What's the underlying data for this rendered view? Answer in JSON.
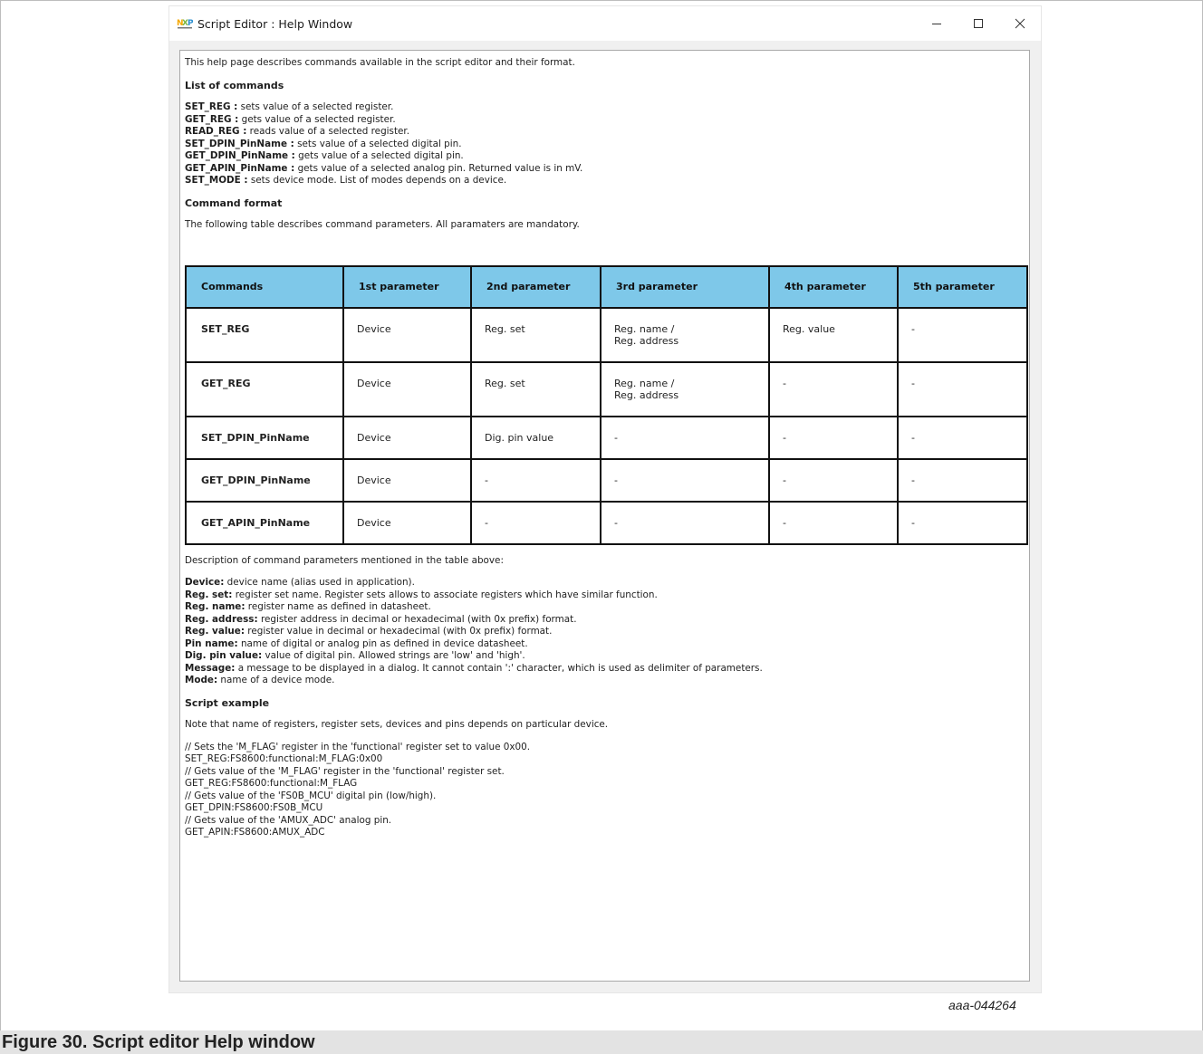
{
  "window": {
    "title": "Script Editor : Help Window",
    "app_icon": "nxp-logo-icon",
    "controls": {
      "minimize": "minimize-icon",
      "maximize": "maximize-icon",
      "close": "close-icon"
    }
  },
  "help": {
    "intro": "This help page describes commands available in the script editor and their format.",
    "list_heading": "List of commands",
    "commands": [
      {
        "name": "SET_REG :",
        "desc": " sets value of a selected register."
      },
      {
        "name": "GET_REG :",
        "desc": " gets value of a selected register."
      },
      {
        "name": "READ_REG :",
        "desc": " reads value of a selected register."
      },
      {
        "name": "SET_DPIN_PinName :",
        "desc": " sets value of a selected digital pin."
      },
      {
        "name": "GET_DPIN_PinName :",
        "desc": " gets value of a selected digital pin."
      },
      {
        "name": "GET_APIN_PinName :",
        "desc": " gets value of a selected analog pin. Returned value is in mV."
      },
      {
        "name": "SET_MODE :",
        "desc": " sets device mode. List of modes depends on a device."
      }
    ],
    "format_heading": "Command format",
    "format_text": "The following table describes command parameters. All paramaters are mandatory.",
    "table": {
      "headers": [
        "Commands",
        "1st parameter",
        "2nd parameter",
        "3rd parameter",
        "4th parameter",
        "5th parameter"
      ],
      "rows": [
        [
          "SET_REG",
          "Device",
          "Reg. set",
          "Reg. name /",
          "Reg. value",
          "-"
        ],
        [
          "GET_REG",
          "Device",
          "Reg. set",
          "Reg. name /",
          "-",
          "-"
        ],
        [
          "SET_DPIN_PinName",
          "Device",
          "Dig. pin value",
          "-",
          "-",
          "-"
        ],
        [
          "GET_DPIN_PinName",
          "Device",
          "-",
          "-",
          "-",
          "-"
        ],
        [
          "GET_APIN_PinName",
          "Device",
          "-",
          "-",
          "-",
          "-"
        ]
      ],
      "row_extra": [
        "Reg. address",
        "Reg. address"
      ]
    },
    "params_intro": "Description of command parameters mentioned in the table above:",
    "params": [
      {
        "name": "Device:",
        "desc": " device name (alias used in application)."
      },
      {
        "name": "Reg. set:",
        "desc": " register set name. Register sets allows to associate registers which have similar function."
      },
      {
        "name": "Reg. name:",
        "desc": " register name as defined in datasheet."
      },
      {
        "name": "Reg. address:",
        "desc": " register address in decimal or hexadecimal (with 0x prefix) format."
      },
      {
        "name": "Reg. value:",
        "desc": " register value in decimal or hexadecimal (with 0x prefix) format."
      },
      {
        "name": "Pin name:",
        "desc": " name of digital or analog pin as defined in device datasheet."
      },
      {
        "name": "Dig. pin value:",
        "desc": " value of digital pin. Allowed strings are 'low' and 'high'."
      },
      {
        "name": "Message:",
        "desc": " a message to be displayed in a dialog. It cannot contain ':' character, which is used as delimiter of parameters."
      },
      {
        "name": "Mode:",
        "desc": " name of a device mode."
      }
    ],
    "example_heading": "Script example",
    "example_note": "Note that name of registers, register sets, devices and pins depends on particular device.",
    "example_lines": [
      "// Sets the 'M_FLAG' register in the 'functional' register set to value 0x00.",
      "SET_REG:FS8600:functional:M_FLAG:0x00",
      "// Gets value of the 'M_FLAG' register in the 'functional' register set.",
      "GET_REG:FS8600:functional:M_FLAG",
      "// Gets value of the 'FS0B_MCU' digital pin (low/high).",
      "GET_DPIN:FS8600:FS0B_MCU",
      "// Gets value of the 'AMUX_ADC' analog pin.",
      "GET_APIN:FS8600:AMUX_ADC"
    ]
  },
  "figure": {
    "id": "aaa-044264",
    "caption": "Figure 30.  Script editor Help window"
  }
}
